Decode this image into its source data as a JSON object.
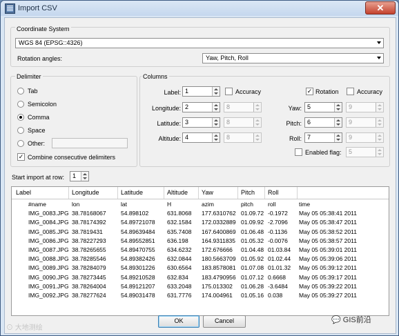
{
  "window": {
    "title": "Import CSV",
    "close_glyph": "✕"
  },
  "coordinate_system": {
    "group_label": "Coordinate System",
    "crs_value": "WGS 84 (EPSG::4326)",
    "rotation_label": "Rotation angles:",
    "rotation_value": "Yaw, Pitch, Roll"
  },
  "delimiter": {
    "group_label": "Delimiter",
    "options": [
      "Tab",
      "Semicolon",
      "Comma",
      "Space",
      "Other:"
    ],
    "selected": "Comma",
    "combine_label": "Combine consecutive delimiters",
    "combine_checked": true
  },
  "columns": {
    "group_label": "Columns",
    "label": {
      "label": "Label:",
      "value": "1"
    },
    "longitude": {
      "label": "Longitude:",
      "value": "2",
      "accuracy": "8"
    },
    "latitude": {
      "label": "Latitude:",
      "value": "3",
      "accuracy": "8"
    },
    "altitude": {
      "label": "Altitude:",
      "value": "4",
      "accuracy": "8"
    },
    "accuracy_label": "Accuracy",
    "rotation_label": "Rotation",
    "rotation_checked": true,
    "accuracy2_label": "Accuracy",
    "yaw": {
      "label": "Yaw:",
      "value": "5",
      "accuracy": "9"
    },
    "pitch": {
      "label": "Pitch:",
      "value": "6",
      "accuracy": "9"
    },
    "roll": {
      "label": "Roll:",
      "value": "7",
      "accuracy": "9"
    },
    "enabled_flag_label": "Enabled flag:",
    "enabled_flag_value": "5"
  },
  "start_row": {
    "label": "Start import at row:",
    "value": "1"
  },
  "preview": {
    "headers": [
      "Label",
      "Longitude",
      "Latitude",
      "Altitude",
      "Yaw",
      "Pitch",
      "Roll"
    ],
    "rows": [
      [
        "#name",
        "lon",
        "lat",
        "H",
        "azim",
        "pitch",
        "roll",
        "time"
      ],
      [
        "IMG_0083.JPG",
        "38.78168067",
        "54.898102",
        "631.8068",
        "177.6310762",
        "01.09.72",
        "-0.1972",
        "May 05 05:38:41 2011"
      ],
      [
        "IMG_0084.JPG",
        "38.78174392",
        "54.89721078",
        "632.1584",
        "172.0332889",
        "01.09.92",
        "-2.7096",
        "May 05 05:38:47 2011"
      ],
      [
        "IMG_0085.JPG",
        "38.7819431",
        "54.89639484",
        "635.7408",
        "167.6400869",
        "01.06.48",
        "-0.1136",
        "May 05 05:38:52 2011"
      ],
      [
        "IMG_0086.JPG",
        "38.78227293",
        "54.89552851",
        "636.198",
        "164.9311835",
        "01.05.32",
        "-0.0076",
        "May 05 05:38:57 2011"
      ],
      [
        "IMG_0087.JPG",
        "38.78265655",
        "54.89470755",
        "634.6232",
        "172.676666",
        "01.04.48",
        "01.03.84",
        "May 05 05:39:01 2011"
      ],
      [
        "IMG_0088.JPG",
        "38.78285546",
        "54.89382426",
        "632.0844",
        "180.5663709",
        "01.05.92",
        "01.02.44",
        "May 05 05:39:06 2011"
      ],
      [
        "IMG_0089.JPG",
        "38.78284079",
        "54.89301226",
        "630.6564",
        "183.8578081",
        "01.07.08",
        "01.01.32",
        "May 05 05:39:12 2011"
      ],
      [
        "IMG_0090.JPG",
        "38.78273445",
        "54.89210528",
        "632.834",
        "183.4790956",
        "01.07.12",
        "0.6668",
        "May 05 05:39:17 2011"
      ],
      [
        "IMG_0091.JPG",
        "38.78264004",
        "54.89121207",
        "633.2048",
        "175.013302",
        "01.06.28",
        "-3.6484",
        "May 05 05:39:22 2011"
      ],
      [
        "IMG_0092.JPG",
        "38.78277624",
        "54.89031478",
        "631.7776",
        "174.004961",
        "01.05.16",
        "0.038",
        "May 05 05:39:27 2011"
      ]
    ]
  },
  "buttons": {
    "ok": "OK",
    "cancel": "Cancel"
  },
  "watermarks": {
    "left": "⊙ 大地测绘",
    "right": "GIS前沿"
  }
}
